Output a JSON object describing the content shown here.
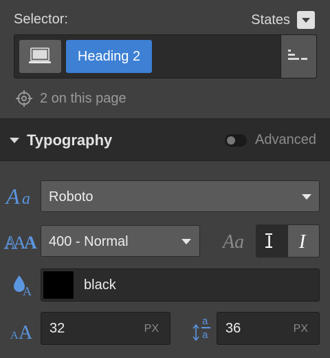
{
  "selector": {
    "label": "Selector:",
    "states_label": "States",
    "tag": "Heading 2",
    "on_page": "2 on this page"
  },
  "typography": {
    "title": "Typography",
    "advanced_label": "Advanced",
    "font": "Roboto",
    "weight": "400 - Normal",
    "color_name": "black",
    "color_hex": "#000000",
    "size": {
      "value": "32",
      "unit": "PX"
    },
    "line_height": {
      "value": "36",
      "unit": "PX"
    }
  },
  "colors": {
    "accent": "#3d80d4",
    "icon_blue": "#5b96e0"
  }
}
